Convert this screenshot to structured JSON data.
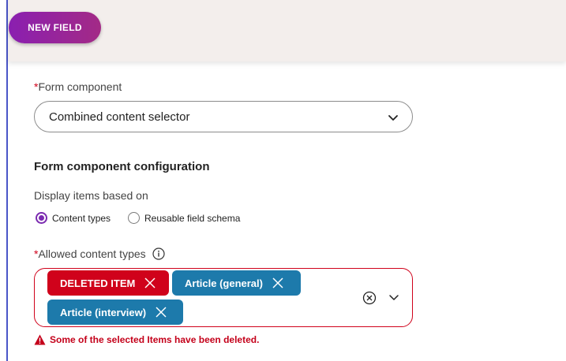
{
  "toolbar": {
    "new_field_label": "NEW FIELD"
  },
  "form_component": {
    "required_mark": "*",
    "label": "Form component",
    "selected_value": "Combined content selector"
  },
  "config": {
    "heading": "Form component configuration",
    "display_label": "Display items based on",
    "radio_options": [
      {
        "label": "Content types",
        "checked": true
      },
      {
        "label": "Reusable field schema",
        "checked": false
      }
    ]
  },
  "allowed": {
    "required_mark": "*",
    "label": "Allowed content types",
    "chips": [
      {
        "label": "DELETED ITEM",
        "state": "deleted"
      },
      {
        "label": "Article (general)",
        "state": "ok"
      },
      {
        "label": "Article (interview)",
        "state": "ok"
      }
    ],
    "error_message": "Some of the selected Items have been deleted."
  },
  "colors": {
    "accent_purple": "#7b2bb0",
    "chip_blue": "#1d7aab",
    "error_red": "#d0021b"
  },
  "icons": [
    "chevron-down-icon",
    "info-icon",
    "close-icon",
    "clear-circle-icon",
    "warning-icon"
  ]
}
